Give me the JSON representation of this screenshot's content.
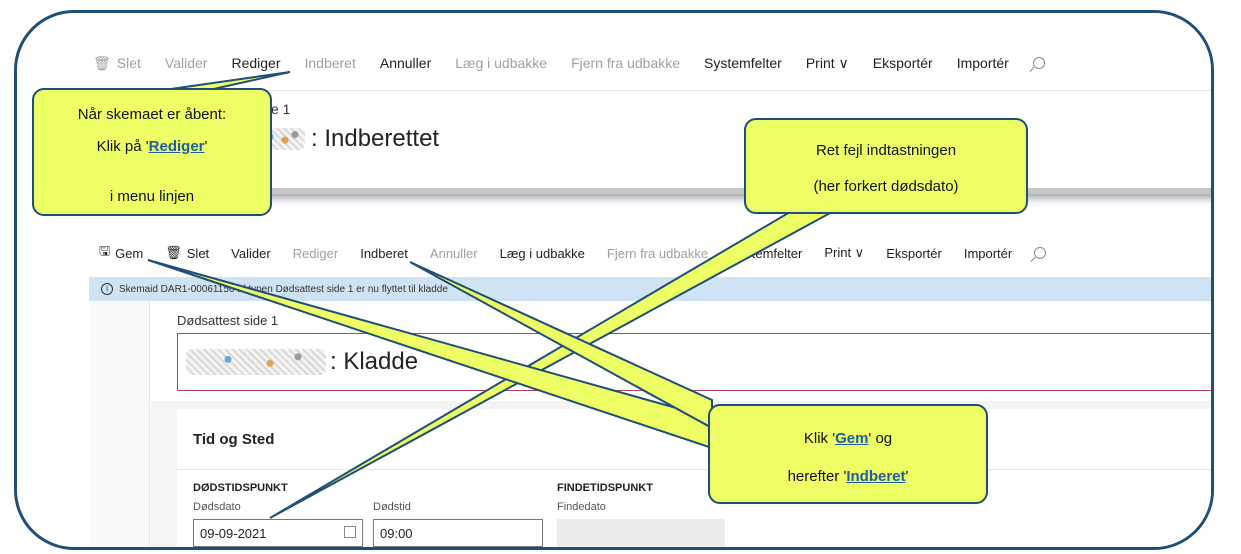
{
  "top_screenshot": {
    "toolbar": [
      {
        "icon": "trash-icon",
        "label": "Slet",
        "enabled": false
      },
      {
        "label": "Valider",
        "enabled": false
      },
      {
        "label": "Rediger",
        "enabled": true
      },
      {
        "label": "Indberet",
        "enabled": false
      },
      {
        "label": "Annuller",
        "enabled": true
      },
      {
        "label": "Læg i udbakke",
        "enabled": false
      },
      {
        "label": "Fjern fra udbakke",
        "enabled": false
      },
      {
        "label": "Systemfelter",
        "enabled": true
      },
      {
        "label": "Print ∨",
        "enabled": true
      },
      {
        "label": "Eksportér",
        "enabled": true
      },
      {
        "label": "Importér",
        "enabled": true
      }
    ],
    "subtitle": "e 1",
    "title": ": Indberettet"
  },
  "bottom_screenshot": {
    "toolbar": [
      {
        "icon": "save-icon",
        "label": "Gem",
        "enabled": true
      },
      {
        "icon": "trash-icon",
        "label": "Slet",
        "enabled": true
      },
      {
        "label": "Valider",
        "enabled": true
      },
      {
        "label": "Rediger",
        "enabled": false
      },
      {
        "label": "Indberet",
        "enabled": true
      },
      {
        "label": "Annuller",
        "enabled": false
      },
      {
        "label": "Læg i udbakke",
        "enabled": true
      },
      {
        "label": "Fjern fra udbakke",
        "enabled": false
      },
      {
        "label": "Systemfelter",
        "enabled": true
      },
      {
        "label": "Print ∨",
        "enabled": true
      },
      {
        "label": "Eksportér",
        "enabled": true
      },
      {
        "label": "Importér",
        "enabled": true
      }
    ],
    "info": "Skemaid DAR1-00061156 af typen Dødsattest side 1 er nu flyttet til kladde",
    "subtitle": "Dødsattest side 1",
    "title": ": Kladde",
    "section_title": "Tid og Sted",
    "group1": "DØDSTIDSPUNKT",
    "group2": "FINDETIDSPUNKT",
    "labels": {
      "dodsdato": "Dødsdato",
      "dodstid": "Dødstid",
      "findedato": "Findedato"
    },
    "values": {
      "dodsdato": "09-09-2021",
      "dodstid": "09:00",
      "findedato": ""
    }
  },
  "callouts": {
    "c1": {
      "line1": "Når skemaet er åbent:",
      "line2a": "Klik på '",
      "line2link": "Rediger",
      "line2b": "'",
      "line3": "i menu linjen"
    },
    "c2": {
      "line1": "Ret fejl indtastningen",
      "line2": "(her forkert dødsdato)"
    },
    "c3": {
      "line1a": "Klik '",
      "line1link": "Gem",
      "line1b": "' og",
      "line2a": "herefter '",
      "line2link": "Indberet",
      "line2b": "'"
    }
  },
  "colors": {
    "frame": "#1f4e79",
    "callout_fill": "#eeff66",
    "info_bar": "#cfe3f5",
    "link": "#1f5fa0"
  }
}
